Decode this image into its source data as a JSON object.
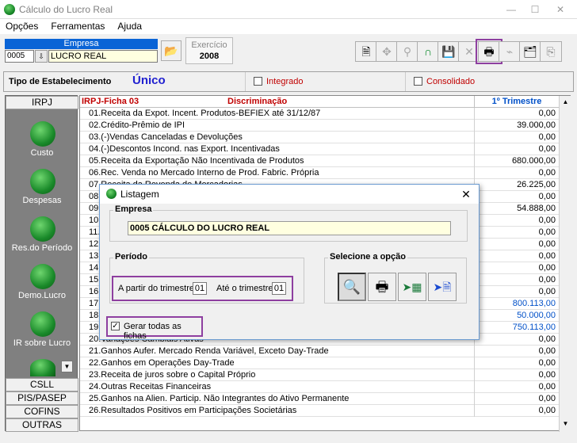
{
  "window": {
    "title": "Cálculo do Lucro Real"
  },
  "menu": [
    "Opções",
    "Ferramentas",
    "Ajuda"
  ],
  "empresa": {
    "label": "Empresa",
    "code": "0005",
    "name": "LUCRO REAL"
  },
  "exercicio": {
    "label": "Exercício",
    "value": "2008"
  },
  "estab": {
    "label": "Tipo de Estabelecimento",
    "value": "Único",
    "integrado": "Integrado",
    "consolidado": "Consolidado"
  },
  "left_tabs": {
    "top": "IRPJ",
    "csll": "CSLL",
    "pis": "PIS/PASEP",
    "cofins": "COFINS",
    "outras": "OUTRAS"
  },
  "left_items": [
    "Custo",
    "Despesas",
    "Res.do Período",
    "Demo.Lucro",
    "IR sobre Lucro"
  ],
  "grid": {
    "ficha": "IRPJ-Ficha  03",
    "disc": "Discriminação",
    "col": "1º Trimestre",
    "rows": [
      {
        "l": "01.Receita da Expot. Incent. Produtos-BEFIEX até 31/12/87",
        "v": "0,00"
      },
      {
        "l": "02.Crédito-Prêmio de IPI",
        "v": "39.000,00"
      },
      {
        "l": "03.(-)Vendas Canceladas e Devoluções",
        "v": "0,00"
      },
      {
        "l": "04.(-)Descontos Incond. nas Export. Incentivadas",
        "v": "0,00"
      },
      {
        "l": "05.Receita da Exportação Não Incentivada de Produtos",
        "v": "680.000,00"
      },
      {
        "l": "06.Rec. Venda no Mercado Interno de Prod. Fabric. Própria",
        "v": "0,00"
      },
      {
        "l": "07.Receita da Revenda de Mercadorias",
        "v": "26.225,00"
      },
      {
        "l": "08.",
        "v": "0,00"
      },
      {
        "l": "09.",
        "v": "54.888,00"
      },
      {
        "l": "10.",
        "v": "0,00"
      },
      {
        "l": "11.",
        "v": "0,00"
      },
      {
        "l": "12.",
        "v": "0,00"
      },
      {
        "l": "13.",
        "v": "0,00"
      },
      {
        "l": "14.",
        "v": "0,00"
      },
      {
        "l": "15.",
        "v": "0,00"
      },
      {
        "l": "16.",
        "v": "0,00"
      },
      {
        "l": "17.RE",
        "v": "800.113,00",
        "blue": true
      },
      {
        "l": "18.",
        "v": "50.000,00",
        "blue": true
      },
      {
        "l": "19.LU",
        "v": "750.113,00",
        "blue": true
      },
      {
        "l": "20.Variações Cambiais Ativas",
        "v": "0,00"
      },
      {
        "l": "21.Ganhos Aufer. Mercado Renda Variável, Exceto Day-Trade",
        "v": "0,00"
      },
      {
        "l": "22.Ganhos em Operações Day-Trade",
        "v": "0,00"
      },
      {
        "l": "23.Receita de juros sobre o Capital Próprio",
        "v": "0,00"
      },
      {
        "l": "24.Outras Receitas Financeiras",
        "v": "0,00"
      },
      {
        "l": "25.Ganhos na Alien. Particip. Não Integrantes do Ativo Permanente",
        "v": "0,00"
      },
      {
        "l": "26.Resultados Positivos em Participações Societárias",
        "v": "0,00"
      }
    ]
  },
  "dialog": {
    "title": "Listagem",
    "empresa_label": "Empresa",
    "empresa_code": "0005",
    "empresa_name": "CÁLCULO DO LUCRO REAL",
    "periodo_label": "Período",
    "de_label": "A partir do trimestre",
    "de_val": "01",
    "ate_label": "Até o trimestre",
    "ate_val": "01",
    "opcao_label": "Selecione a opção",
    "gerar": "Gerar todas as fichas"
  }
}
